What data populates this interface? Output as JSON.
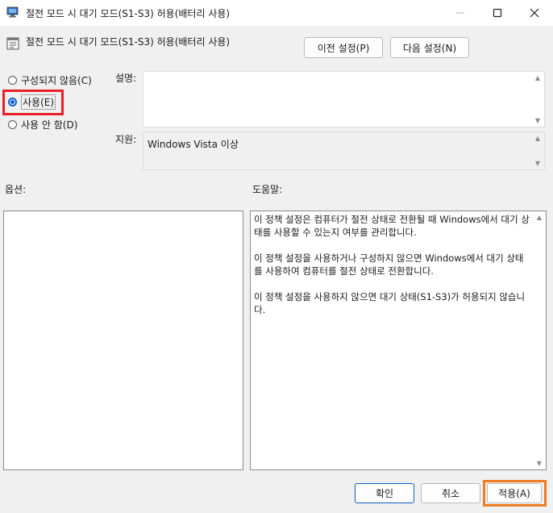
{
  "window": {
    "title": "절전 모드 시 대기 모드(S1-S3) 허용(배터리 사용)",
    "minimize_icon": "minimize-icon",
    "maximize_icon": "maximize-icon",
    "close_icon": "close-icon"
  },
  "header": {
    "policy_name": "절전 모드 시 대기 모드(S1-S3) 허용(배터리 사용)",
    "prev_button": "이전 설정(P)",
    "next_button": "다음 설정(N)"
  },
  "state": {
    "options": [
      {
        "label": "구성되지 않음(C)",
        "checked": false
      },
      {
        "label": "사용(E)",
        "checked": true
      },
      {
        "label": "사용 안 함(D)",
        "checked": false
      }
    ]
  },
  "comment": {
    "label": "설명:",
    "value": ""
  },
  "supported": {
    "label": "지원:",
    "value": "Windows Vista 이상"
  },
  "options_pane": {
    "label": "옵션:"
  },
  "help": {
    "label": "도움말:",
    "paragraphs": [
      "이 정책 설정은 컴퓨터가 절전 상태로 전환될 때 Windows에서 대기 상태를 사용할 수 있는지 여부를 관리합니다.",
      "이 정책 설정을 사용하거나 구성하지 않으면 Windows에서 대기 상태를 사용하여 컴퓨터를 절전 상태로 전환합니다.",
      "이 정책 설정을 사용하지 않으면 대기 상태(S1-S3)가 허용되지 않습니다."
    ]
  },
  "footer": {
    "ok": "확인",
    "cancel": "취소",
    "apply": "적용(A)"
  },
  "colors": {
    "highlight_red": "#e8202a",
    "highlight_orange": "#f07b20",
    "accent": "#0a5fc8"
  }
}
